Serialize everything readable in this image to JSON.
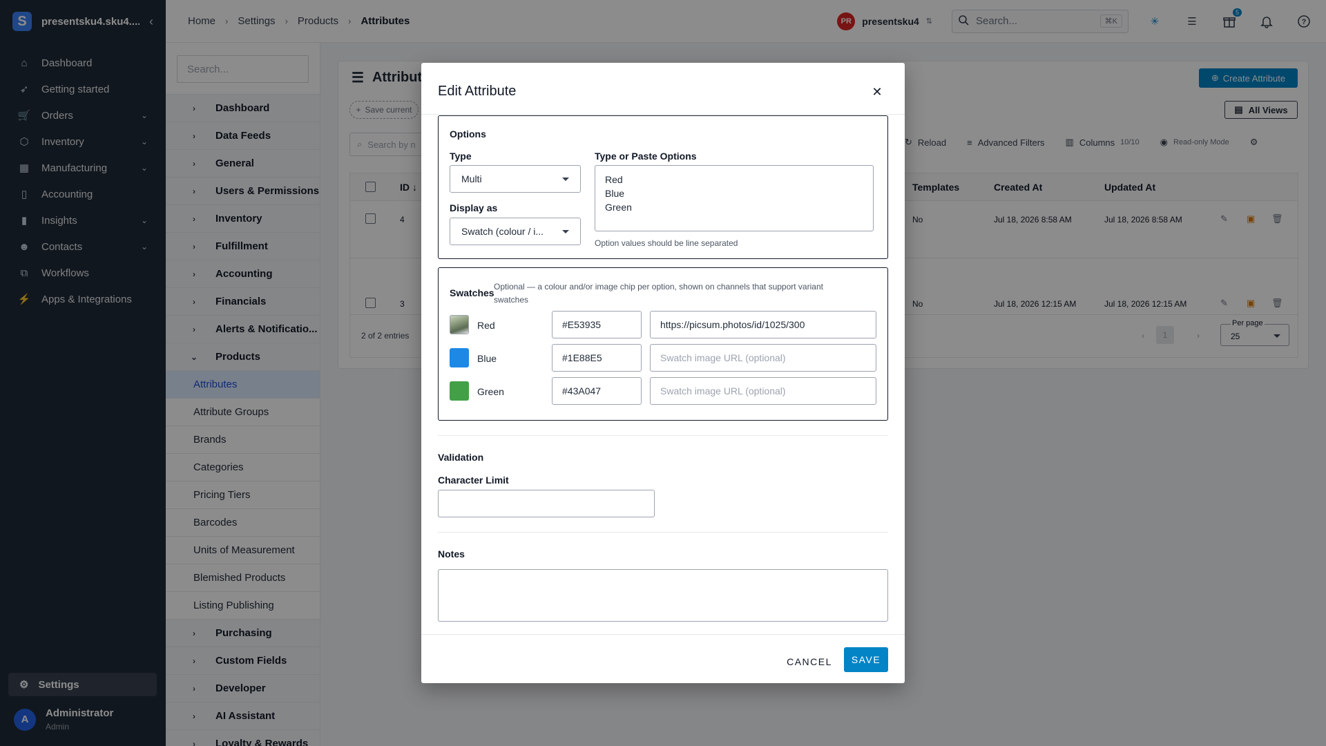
{
  "app": {
    "title": "presentsku4.sku4...."
  },
  "sidebar": {
    "items": [
      {
        "label": "Dashboard",
        "icon": "home-icon",
        "chevron": false
      },
      {
        "label": "Getting started",
        "icon": "rocket-icon",
        "chevron": false
      },
      {
        "label": "Orders",
        "icon": "cart-icon",
        "chevron": true
      },
      {
        "label": "Inventory",
        "icon": "box-icon",
        "chevron": true
      },
      {
        "label": "Manufacturing",
        "icon": "factory-icon",
        "chevron": true
      },
      {
        "label": "Accounting",
        "icon": "book-icon",
        "chevron": false
      },
      {
        "label": "Insights",
        "icon": "chart-icon",
        "chevron": true
      },
      {
        "label": "Contacts",
        "icon": "users-icon",
        "chevron": true
      },
      {
        "label": "Workflows",
        "icon": "workflow-icon",
        "chevron": false
      },
      {
        "label": "Apps & Integrations",
        "icon": "plug-icon",
        "chevron": false
      }
    ],
    "settings_label": "Settings",
    "user": {
      "initial": "A",
      "name": "Administrator",
      "role": "Admin"
    }
  },
  "topbar": {
    "breadcrumbs": [
      "Home",
      "Settings",
      "Products",
      "Attributes"
    ],
    "user_initials": "PR",
    "user_name": "presentsku4",
    "search_placeholder": "Search...",
    "search_shortcut": "⌘K",
    "gift_badge": "5"
  },
  "subnav": {
    "search_placeholder": "Search...",
    "groups_before": [
      "Dashboard",
      "Data Feeds",
      "General",
      "Users & Permissions",
      "Inventory",
      "Fulfillment",
      "Accounting",
      "Financials",
      "Alerts & Notificatio..."
    ],
    "products_label": "Products",
    "product_children": [
      "Attributes",
      "Attribute Groups",
      "Brands",
      "Categories",
      "Pricing Tiers",
      "Barcodes",
      "Units of Measurement",
      "Blemished Products",
      "Listing Publishing"
    ],
    "groups_after": [
      "Purchasing",
      "Custom Fields",
      "Developer",
      "AI Assistant",
      "Loyalty & Rewards"
    ]
  },
  "page": {
    "title": "Attributes",
    "create_label": "Create Attribute",
    "all_views_label": "All Views",
    "save_current_label": "Save current",
    "search_placeholder": "Search by n",
    "toolbar": {
      "reload": "Reload",
      "advanced_filters": "Advanced Filters",
      "columns": "Columns",
      "columns_count": "10/10",
      "read_only": "Read-only Mode"
    },
    "columns": {
      "id": "ID",
      "templates": "Templates",
      "created_at": "Created At",
      "updated_at": "Updated At"
    },
    "rows": [
      {
        "id": "4",
        "templates": "No",
        "created": "Jul 18, 2026 8:58 AM",
        "updated": "Jul 18, 2026 8:58 AM"
      },
      {
        "id": "3",
        "templates": "No",
        "created": "Jul 18, 2026 12:15 AM",
        "updated": "Jul 18, 2026 12:15 AM"
      }
    ],
    "entries": "2 of 2 entries",
    "page_num": "1",
    "per_page_label": "Per page",
    "per_page": "25"
  },
  "modal": {
    "title": "Edit Attribute",
    "options": {
      "heading": "Options",
      "type_label": "Type",
      "type_value": "Multi",
      "display_label": "Display as",
      "display_value": "Swatch (colour / i...",
      "paste_label": "Type or Paste Options",
      "options_list": [
        "Red",
        "Blue",
        "Green"
      ],
      "helper": "Option values should be line separated"
    },
    "swatches": {
      "heading": "Swatches",
      "description": "Optional — a colour and/or image chip per option, shown on channels that support variant swatches",
      "image_placeholder": "Swatch image URL (optional)",
      "items": [
        {
          "name": "Red",
          "hex": "#E53935",
          "image_url": "https://picsum.photos/id/1025/300",
          "has_image": true
        },
        {
          "name": "Blue",
          "hex": "#1E88E5",
          "image_url": "",
          "has_image": false
        },
        {
          "name": "Green",
          "hex": "#43A047",
          "image_url": "",
          "has_image": false
        }
      ]
    },
    "validation": {
      "heading": "Validation",
      "char_limit_label": "Character Limit",
      "char_limit_value": ""
    },
    "notes": {
      "heading": "Notes",
      "value": ""
    },
    "cancel_label": "CANCEL",
    "save_label": "SAVE"
  }
}
